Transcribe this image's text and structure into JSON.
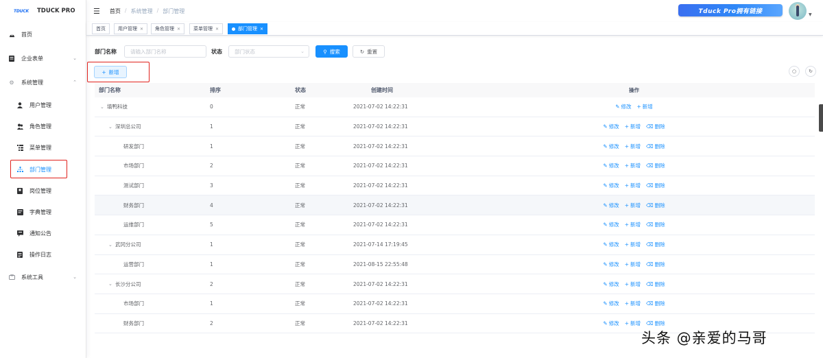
{
  "logo": {
    "mark": "TDUCK",
    "name": "TDUCK PRO"
  },
  "sidebar": {
    "items": [
      {
        "label": "首页",
        "icon": "dashboard-icon"
      },
      {
        "label": "企业表单",
        "icon": "form-icon",
        "expandable": true
      },
      {
        "label": "系统管理",
        "icon": "gear-icon",
        "expandable": true,
        "expanded": true
      },
      {
        "label": "用户管理",
        "icon": "user-icon"
      },
      {
        "label": "角色管理",
        "icon": "peoples-icon"
      },
      {
        "label": "菜单管理",
        "icon": "tree-table-icon"
      },
      {
        "label": "部门管理",
        "icon": "tree-icon",
        "active": true
      },
      {
        "label": "岗位管理",
        "icon": "post-icon"
      },
      {
        "label": "字典管理",
        "icon": "dict-icon"
      },
      {
        "label": "通知公告",
        "icon": "message-icon"
      },
      {
        "label": "操作日志",
        "icon": "log-icon"
      },
      {
        "label": "系统工具",
        "icon": "tool-icon",
        "expandable": true
      }
    ]
  },
  "navbar": {
    "breadcrumb": [
      "首页",
      "系统管理",
      "部门管理"
    ],
    "promo": "Tduck Pro拥有链接"
  },
  "tags": [
    "首页",
    "用户管理",
    "角色管理",
    "菜单管理",
    "部门管理"
  ],
  "search": {
    "dept_label": "部门名称",
    "dept_placeholder": "请输入部门名称",
    "status_label": "状态",
    "status_placeholder": "部门状态",
    "search_btn": "搜索",
    "reset_btn": "重置"
  },
  "toolbar": {
    "add_btn": "新增"
  },
  "table": {
    "headers": {
      "name": "部门名称",
      "sort": "排序",
      "status": "状态",
      "time": "创建时间",
      "ops": "操作"
    },
    "ops": {
      "edit": "修改",
      "add": "新增",
      "delete": "删除"
    },
    "rows": [
      {
        "name": "填鸭科技",
        "sort": "0",
        "status": "正常",
        "time": "2021-07-02 14:22:31",
        "level": 0,
        "expand": true,
        "del": false
      },
      {
        "name": "深圳总公司",
        "sort": "1",
        "status": "正常",
        "time": "2021-07-02 14:22:31",
        "level": 1,
        "expand": true,
        "del": true
      },
      {
        "name": "研发部门",
        "sort": "1",
        "status": "正常",
        "time": "2021-07-02 14:22:31",
        "level": 2,
        "expand": false,
        "del": true
      },
      {
        "name": "市场部门",
        "sort": "2",
        "status": "正常",
        "time": "2021-07-02 14:22:31",
        "level": 2,
        "expand": false,
        "del": true
      },
      {
        "name": "测试部门",
        "sort": "3",
        "status": "正常",
        "time": "2021-07-02 14:22:31",
        "level": 2,
        "expand": false,
        "del": true
      },
      {
        "name": "财务部门",
        "sort": "4",
        "status": "正常",
        "time": "2021-07-02 14:22:31",
        "level": 2,
        "expand": false,
        "del": true,
        "hl": true
      },
      {
        "name": "运维部门",
        "sort": "5",
        "status": "正常",
        "time": "2021-07-02 14:22:31",
        "level": 2,
        "expand": false,
        "del": true
      },
      {
        "name": "武冈分公司",
        "sort": "1",
        "status": "正常",
        "time": "2021-07-14 17:19:45",
        "level": 1,
        "expand": true,
        "del": true
      },
      {
        "name": "运营部门",
        "sort": "1",
        "status": "正常",
        "time": "2021-08-15 22:55:48",
        "level": 2,
        "expand": false,
        "del": true
      },
      {
        "name": "长沙分公司",
        "sort": "2",
        "status": "正常",
        "time": "2021-07-02 14:22:31",
        "level": 1,
        "expand": true,
        "del": true
      },
      {
        "name": "市场部门",
        "sort": "1",
        "status": "正常",
        "time": "2021-07-02 14:22:31",
        "level": 2,
        "expand": false,
        "del": true
      },
      {
        "name": "财务部门",
        "sort": "2",
        "status": "正常",
        "time": "2021-07-02 14:22:31",
        "level": 2,
        "expand": false,
        "del": true
      }
    ]
  },
  "watermark": "头条 @亲爱的马哥",
  "colors": {
    "primary": "#1890ff",
    "highlight_box": "#e0201b"
  }
}
